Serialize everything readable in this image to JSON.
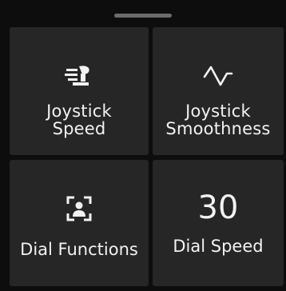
{
  "tiles": [
    {
      "line1": "Joystick",
      "line2": "Speed",
      "icon": "joystick-speed-icon"
    },
    {
      "line1": "Joystick",
      "line2": "Smoothness",
      "icon": "smoothness-waveform-icon"
    },
    {
      "label": "Dial Functions",
      "icon": "dial-functions-icon"
    },
    {
      "value": "30",
      "label": "Dial Speed"
    }
  ],
  "colors": {
    "background": "#0d0d0d",
    "tile": "#262626",
    "text": "#f2f2f2",
    "handle": "#6b6b6b"
  }
}
